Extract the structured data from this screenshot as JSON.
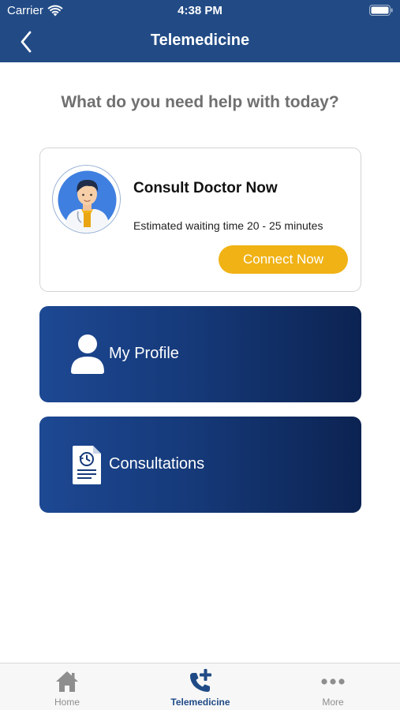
{
  "status_bar": {
    "carrier": "Carrier",
    "time": "4:38 PM",
    "icons": [
      "wifi-icon",
      "battery-icon"
    ]
  },
  "nav": {
    "title": "Telemedicine",
    "back_icon": "chevron-left-icon"
  },
  "main": {
    "question": "What do you need help with today?",
    "consult_card": {
      "title": "Consult Doctor Now",
      "wait_text": "Estimated waiting time 20 - 25 minutes",
      "button_label": "Connect Now",
      "avatar_icon": "doctor-avatar"
    },
    "menu": [
      {
        "label": "My Profile",
        "icon": "user-icon"
      },
      {
        "label": "Consultations",
        "icon": "document-history-icon"
      }
    ]
  },
  "tabs": [
    {
      "label": "Home",
      "icon": "home-icon",
      "active": false
    },
    {
      "label": "Telemedicine",
      "icon": "phone-plus-icon",
      "active": true
    },
    {
      "label": "More",
      "icon": "more-dots-icon",
      "active": false
    }
  ],
  "colors": {
    "header": "#224b86",
    "accent_button": "#f0b215",
    "card_gradient_start": "#1d4893",
    "card_gradient_end": "#0c2352",
    "active_tab": "#1f4a86",
    "inactive_tab": "#8e8e8e"
  }
}
